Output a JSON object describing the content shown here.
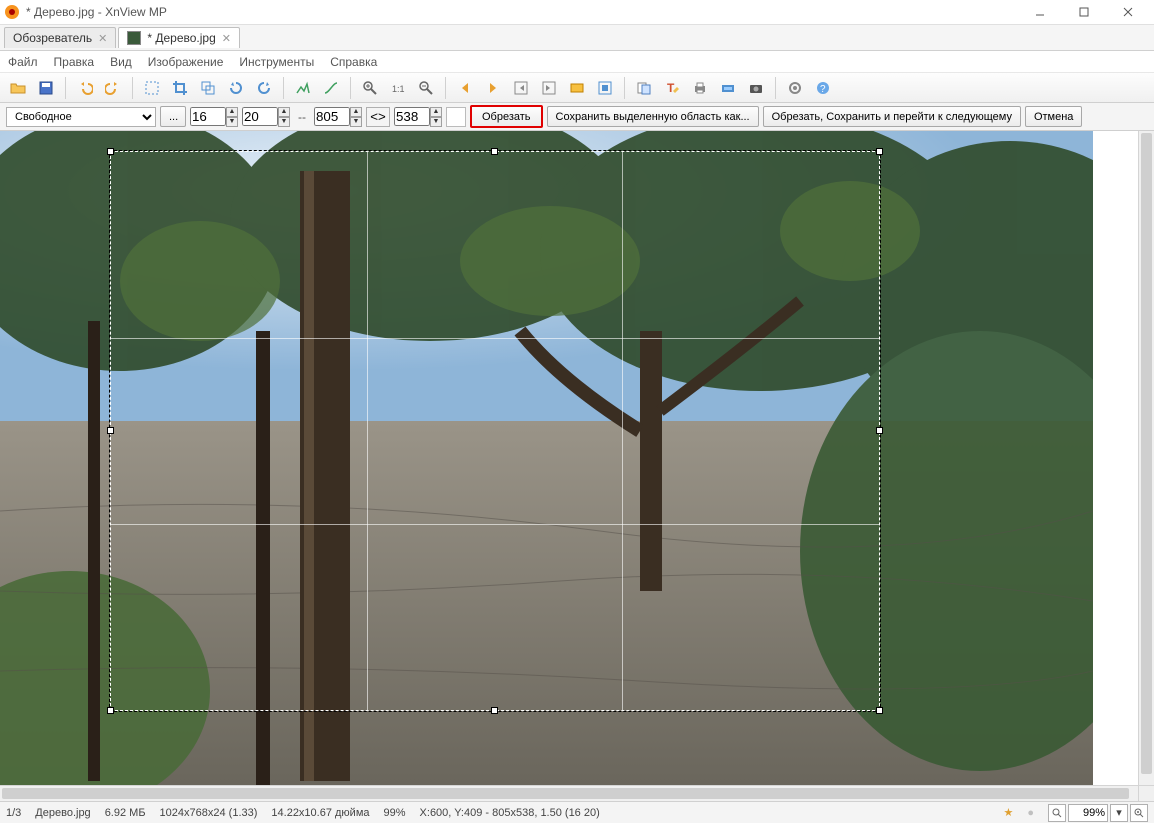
{
  "title": "* Дерево.jpg - XnView MP",
  "tabs": [
    {
      "label": "Обозреватель"
    },
    {
      "label": "* Дерево.jpg"
    }
  ],
  "menu": {
    "file": "Файл",
    "edit": "Правка",
    "view": "Вид",
    "image": "Изображение",
    "tools": "Инструменты",
    "help": "Справка"
  },
  "cropbar": {
    "mode": "Свободное",
    "dots": "...",
    "x": "16",
    "y": "20",
    "dash": "--",
    "w": "805",
    "swap": "<>",
    "h": "538",
    "crop": "Обрезать",
    "save_as": "Сохранить выделенную область как...",
    "crop_next": "Обрезать, Сохранить и перейти к следующему",
    "cancel": "Отмена"
  },
  "status": {
    "index": "1/3",
    "filename": "Дерево.jpg",
    "size": "6.92 МБ",
    "dims": "1024x768x24 (1.33)",
    "phys": "14.22x10.67 дюйма",
    "zoominfo": "99%",
    "coords": "X:600, Y:409 - 805x538, 1.50 (16 20)",
    "zoom": "99%"
  },
  "icons": {
    "open": "open-icon",
    "save": "save-icon",
    "undo": "undo-icon",
    "redo": "redo-icon",
    "select": "select-icon",
    "crop": "crop-icon",
    "resize": "resize-icon",
    "rotate-l": "rotate-left-icon",
    "rotate-r": "rotate-right-icon",
    "levels": "levels-icon",
    "curves": "curves-icon",
    "zoomin": "zoom-in-icon",
    "zoomfit": "zoom-fit-icon",
    "zoomout": "zoom-out-icon",
    "prev": "prev-icon",
    "next": "next-icon",
    "first": "first-icon",
    "last": "last-icon",
    "slideshow": "slideshow-icon",
    "fullscreen": "fullscreen-icon",
    "convert": "convert-icon",
    "text": "text-tool-icon",
    "print": "print-icon",
    "scan": "scan-icon",
    "camera": "camera-icon",
    "settings": "settings-icon",
    "help": "help-icon"
  }
}
